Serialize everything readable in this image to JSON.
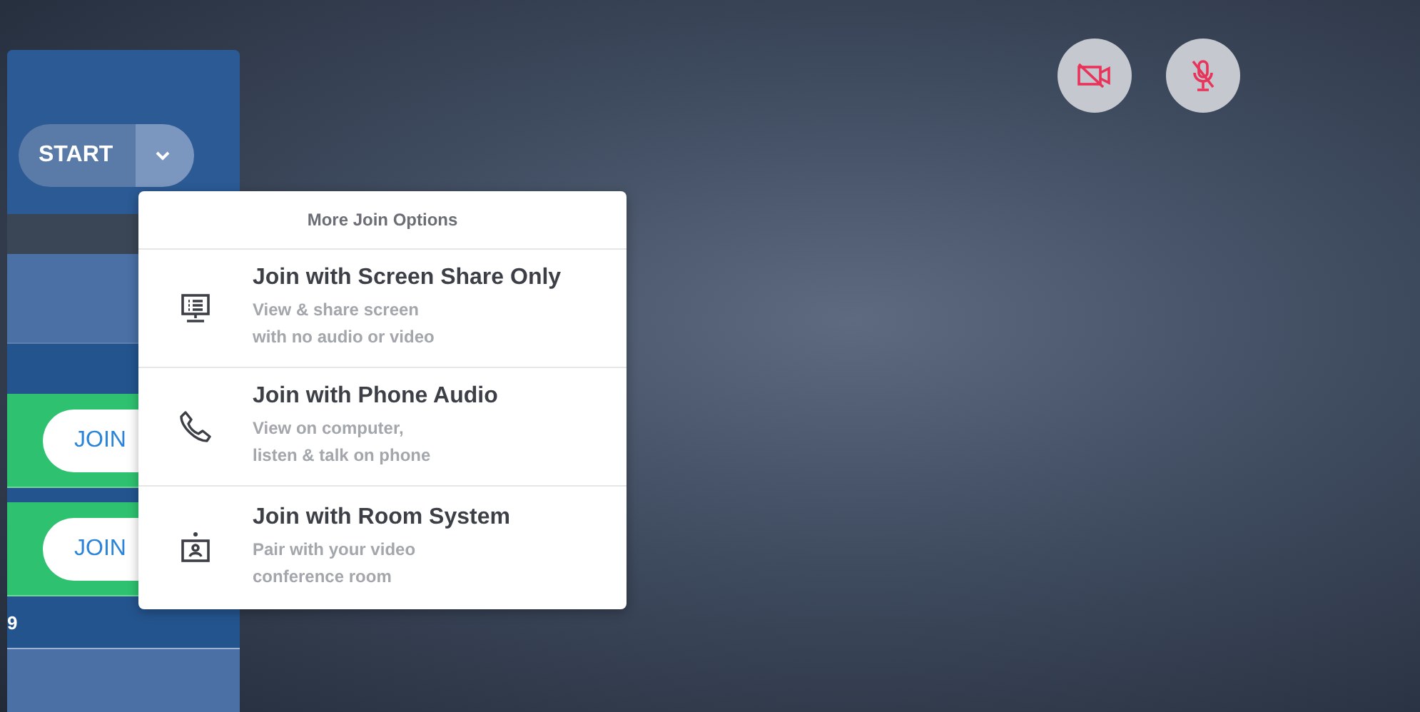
{
  "start_button": {
    "label": "START"
  },
  "meetings": [
    {
      "join_label": "JOIN"
    },
    {
      "join_label": "JOIN"
    }
  ],
  "footer_text": "9",
  "menu": {
    "title": "More Join Options",
    "options": [
      {
        "kind": "screen",
        "title": "Join with Screen Share Only",
        "lines": [
          "View & share screen",
          "with no audio or video"
        ]
      },
      {
        "kind": "phone",
        "title": "Join with Phone Audio",
        "lines": [
          "View on computer,",
          "listen & talk on phone"
        ]
      },
      {
        "kind": "room",
        "title": "Join with Room System",
        "lines": [
          "Pair with your video",
          "conference room"
        ]
      }
    ]
  },
  "controls": [
    {
      "kind": "camera",
      "muted": true
    },
    {
      "kind": "mic",
      "muted": true
    }
  ]
}
